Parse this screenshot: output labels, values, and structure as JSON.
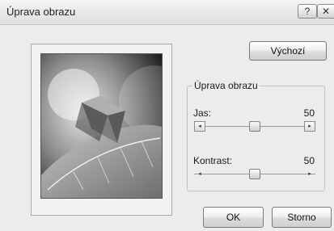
{
  "dialog": {
    "title": "Úprava obrazu",
    "help_glyph": "?",
    "close_glyph": "✕"
  },
  "buttons": {
    "default_label": "Výchozí",
    "ok_label": "OK",
    "cancel_label": "Storno"
  },
  "adjust_group": {
    "legend": "Úprava obrazu",
    "brightness": {
      "label": "Jas:",
      "value": "50",
      "level_percent": 50
    },
    "contrast": {
      "label": "Kontrast:",
      "value": "50",
      "level_percent": 50
    }
  },
  "icons": {
    "slider_left": "◂",
    "slider_right": "▸"
  }
}
